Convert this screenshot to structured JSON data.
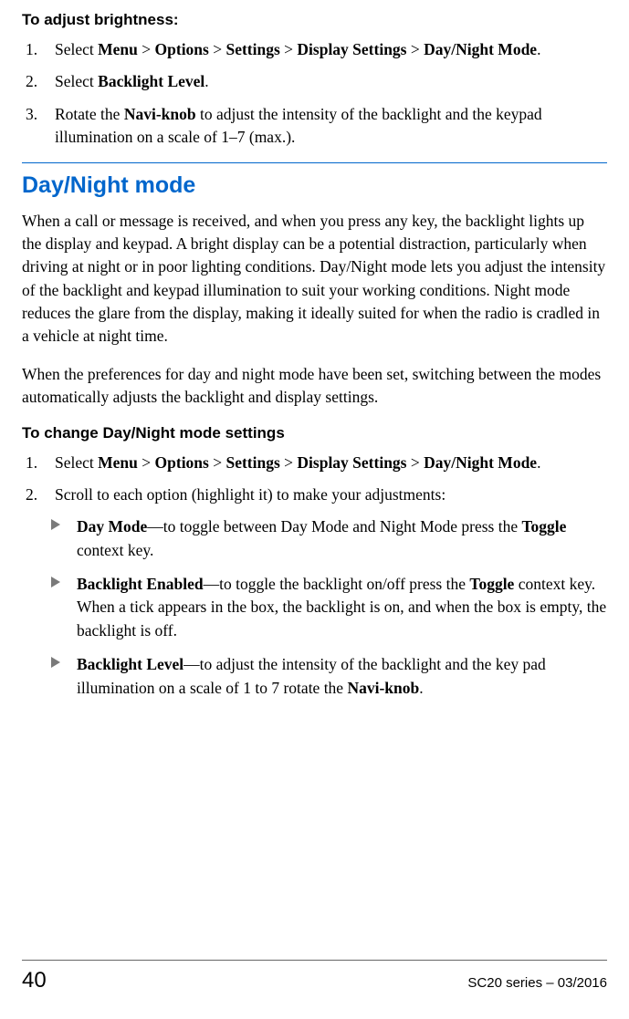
{
  "section1": {
    "heading": "To adjust brightness:",
    "steps": [
      {
        "pre": "Select ",
        "path": [
          "Menu",
          "Options",
          "Settings",
          "Display Settings",
          "Day/Night Mode"
        ],
        "post": "."
      },
      {
        "pre": "Select ",
        "bold": "Backlight Level",
        "post": "."
      },
      {
        "pre": "Rotate the ",
        "bold": "Navi-knob",
        "post": " to adjust the intensity of the backlight and the keypad illumination on a scale of 1–7 (max.)."
      }
    ]
  },
  "section2": {
    "title": "Day/Night mode",
    "para1": "When a call or message is received, and when you press any key, the backlight lights up the display and keypad. A bright display can be a potential distraction, particularly when driving at night or in poor lighting conditions. Day/Night mode lets you adjust the intensity of the backlight and keypad illumination to suit your working conditions. Night mode reduces the glare from the display, making it ideally suited for when the radio is cradled in a vehicle at night time.",
    "para2": "When the preferences for day and night mode have been set, switching between the modes automatically adjusts the backlight and display settings.",
    "subheading": "To change Day/Night mode settings",
    "steps": [
      {
        "pre": "Select ",
        "path": [
          "Menu",
          "Options",
          "Settings",
          "Display Settings",
          "Day/Night Mode"
        ],
        "post": "."
      },
      {
        "text": "Scroll to each option (highlight it) to make your adjustments:"
      }
    ],
    "bullets": [
      {
        "bold1": "Day Mode",
        "mid1": "—to toggle between Day Mode and Night Mode press the ",
        "bold2": "Toggle",
        "mid2": " context key."
      },
      {
        "bold1": "Backlight Enabled",
        "mid1": "—to toggle the backlight on/off press the ",
        "bold2": "Toggle",
        "mid2": " context key. When a tick appears in the box, the backlight is on, and when the box is empty, the backlight is off."
      },
      {
        "bold1": "Backlight Level",
        "mid1": "—to adjust the intensity of the backlight and the key pad illumination on a scale of 1 to 7 rotate the ",
        "bold2": "Navi-knob",
        "mid2": "."
      }
    ]
  },
  "footer": {
    "page": "40",
    "doc": "SC20 series – 03/2016"
  },
  "sep": " > "
}
